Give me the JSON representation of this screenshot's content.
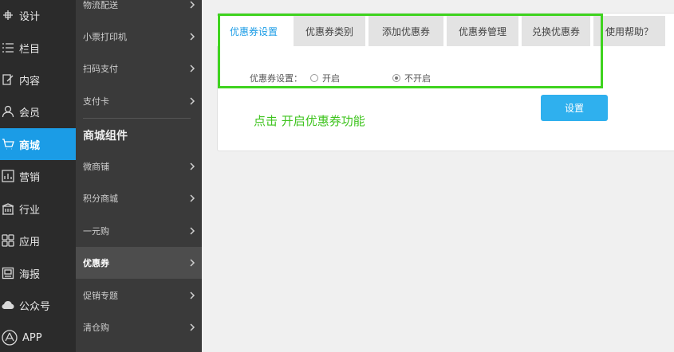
{
  "nav1": {
    "items": [
      {
        "label": "设计",
        "icon": "design-icon"
      },
      {
        "label": "栏目",
        "icon": "list-icon"
      },
      {
        "label": "内容",
        "icon": "edit-icon"
      },
      {
        "label": "会员",
        "icon": "user-icon"
      },
      {
        "label": "商城",
        "icon": "cart-icon"
      },
      {
        "label": "营销",
        "icon": "chart-icon"
      },
      {
        "label": "行业",
        "icon": "building-icon"
      },
      {
        "label": "应用",
        "icon": "apps-icon"
      },
      {
        "label": "海报",
        "icon": "poster-icon"
      },
      {
        "label": "公众号",
        "icon": "cloud-icon"
      },
      {
        "label": "APP",
        "icon": "app-store-icon"
      }
    ],
    "active": "商城"
  },
  "nav2": {
    "items": [
      "物流配送",
      "小票打印机",
      "扫码支付",
      "支付卡",
      "微商铺",
      "积分商城",
      "一元购",
      "优惠券",
      "促销专题",
      "清仓购"
    ],
    "section_title": "商城组件",
    "active": "优惠券"
  },
  "tabs": [
    "优惠券设置",
    "优惠券类别",
    "添加优惠券",
    "优惠券管理",
    "兑换优惠券",
    "使用帮助？"
  ],
  "active_tab": "优惠券设置",
  "form": {
    "label": "优惠券设置：",
    "option_on": "开启",
    "option_off": "不开启",
    "selected": "不开启"
  },
  "set_button": "设置",
  "hint": "点击 开启优惠券功能",
  "colors": {
    "accent": "#1b9ce6",
    "highlight": "#3fd31f",
    "hint": "#3fc41f"
  }
}
